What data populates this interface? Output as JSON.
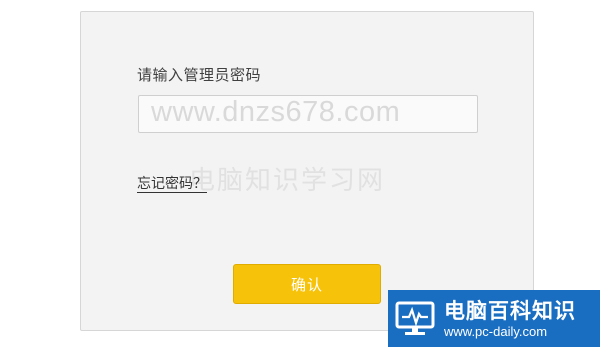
{
  "login": {
    "prompt_label": "请输入管理员密码",
    "password_value": "",
    "forgot_link": "忘记密码？",
    "confirm_label": "确认"
  },
  "watermark": {
    "url_text": "www.dnzs678.com",
    "cn_text": "电脑知识学习网"
  },
  "corner_logo": {
    "title": "电脑百科知识",
    "url": "www.pc-daily.com",
    "icon": "monitor-heartbeat-icon"
  },
  "colors": {
    "panel_background": "#f3f3f3",
    "confirm_button": "#f7c20a",
    "logo_background": "#1a6ec2"
  }
}
